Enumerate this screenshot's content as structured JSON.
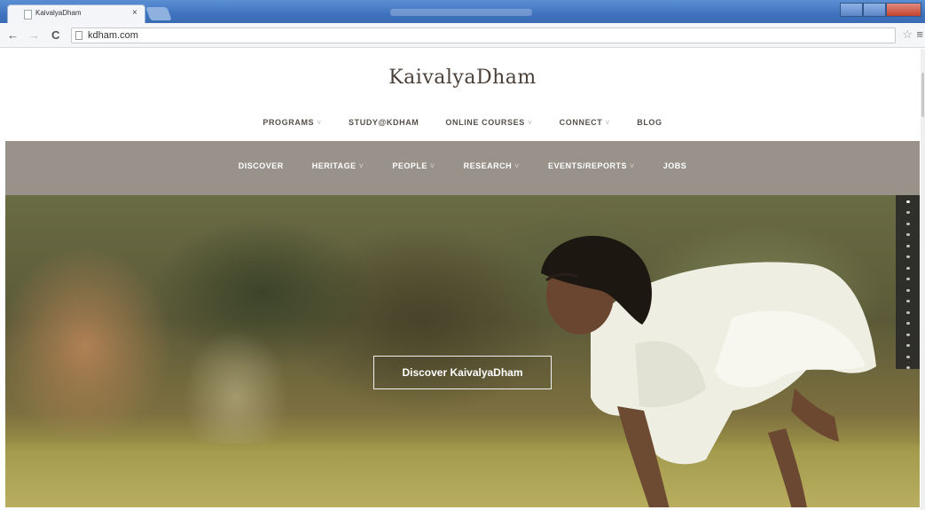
{
  "browser": {
    "tab_title": "KaivalyaDham",
    "tab_close": "×",
    "url": "kdham.com",
    "back": "←",
    "forward": "→",
    "reload": "C",
    "star": "☆",
    "menu": "≡"
  },
  "site": {
    "logo": "KaivalyaDham",
    "top_nav": [
      {
        "label": "PROGRAMS",
        "dropdown": true
      },
      {
        "label": "STUDY@KDHAM",
        "dropdown": false
      },
      {
        "label": "ONLINE COURSES",
        "dropdown": true
      },
      {
        "label": "CONNECT",
        "dropdown": true
      },
      {
        "label": "BLOG",
        "dropdown": false
      }
    ],
    "sub_nav": [
      {
        "label": "DISCOVER",
        "dropdown": false
      },
      {
        "label": "HERITAGE",
        "dropdown": true
      },
      {
        "label": "PEOPLE",
        "dropdown": true
      },
      {
        "label": "RESEARCH",
        "dropdown": true
      },
      {
        "label": "EVENTS/REPORTS",
        "dropdown": true
      },
      {
        "label": "JOBS",
        "dropdown": false
      }
    ],
    "caret": "˅",
    "hero_cta": "Discover KaivalyaDham",
    "slides": 16,
    "active_slide": 1
  },
  "colors": {
    "subnav_bg": "#99928a",
    "logo_text": "#4a4038"
  }
}
